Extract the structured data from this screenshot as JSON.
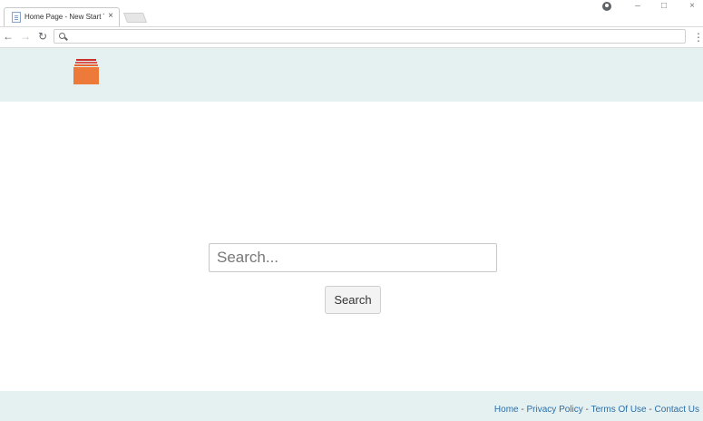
{
  "tab": {
    "title": "Home Page - New Start T",
    "close_glyph": "×",
    "favicon": "page-icon"
  },
  "window": {
    "minimize_glyph": "–",
    "maximize_glyph": "□",
    "close_glyph": "×"
  },
  "toolbar": {
    "back_glyph": "←",
    "forward_glyph": "→",
    "reload_glyph": "↻",
    "address_value": "",
    "menu_glyph": "⋮"
  },
  "search": {
    "placeholder": "Search...",
    "button_label": "Search"
  },
  "footer": {
    "links": [
      "Home",
      "Privacy Policy",
      "Terms Of Use",
      "Contact Us"
    ],
    "separator": "-"
  },
  "colors": {
    "header_bg": "#e5f0f1",
    "logo_orange": "#ee7a3a",
    "logo_red": "#c9302c",
    "link": "#2a6fa8"
  }
}
